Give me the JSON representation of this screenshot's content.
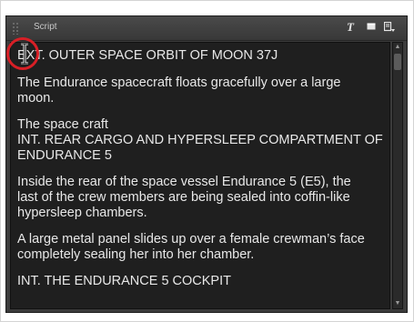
{
  "panel": {
    "title": "Script",
    "text_button": "T",
    "icons": {
      "grip": "grip-dots-icon",
      "window": "window-icon",
      "menu": "panel-menu-icon",
      "cursor": "text-cursor-icon"
    }
  },
  "script": {
    "paragraphs": [
      {
        "lines": [
          "EXT. OUTER SPACE ORBIT OF MOON 37J"
        ]
      },
      {
        "lines": [
          "The Endurance spacecraft floats gracefully over a large",
          "moon."
        ]
      },
      {
        "lines": [
          "The space craft",
          "INT. REAR CARGO AND HYPERSLEEP COMPARTMENT OF",
          "ENDURANCE 5"
        ]
      },
      {
        "lines": [
          "Inside the rear of the space vessel Endurance 5 (E5), the",
          "last of the crew members are being sealed into coffin-like",
          "hypersleep chambers."
        ]
      },
      {
        "lines": [
          "A large metal panel slides up over a female crewman’s face",
          "completely sealing her into her chamber."
        ]
      },
      {
        "lines": [
          "INT. THE ENDURANCE 5 COCKPIT"
        ]
      }
    ]
  },
  "colors": {
    "panel_bg": "#3b3b3b",
    "editor_bg": "#1f1f1f",
    "text": "#e8e8e8",
    "highlight": "#d81f26"
  }
}
